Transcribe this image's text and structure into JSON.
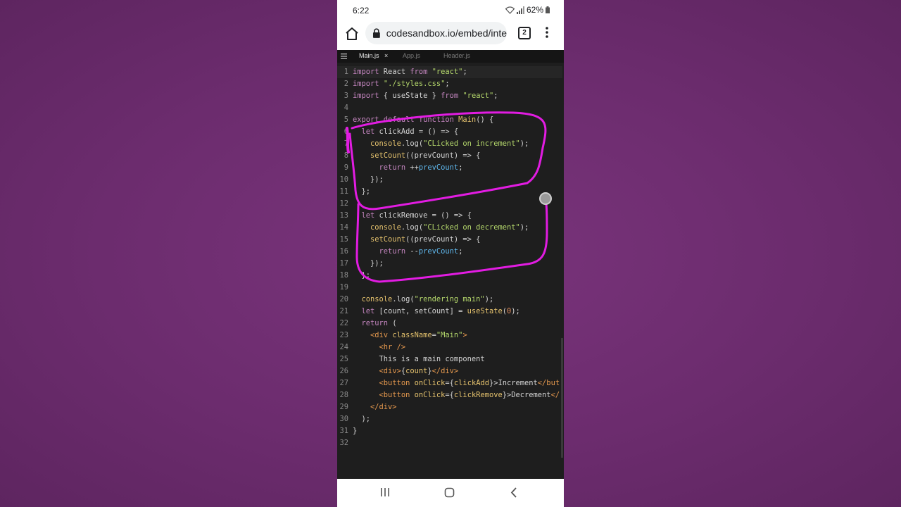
{
  "status_bar": {
    "time": "6:22",
    "battery": "62%"
  },
  "browser": {
    "url": "codesandbox.io/embed/inte",
    "tab_count": "2"
  },
  "editor": {
    "tabs": [
      {
        "label": "Main.js",
        "active": true
      },
      {
        "label": "App.js",
        "active": false
      },
      {
        "label": "Header.js",
        "active": false
      }
    ],
    "close_glyph": "×",
    "line_numbers": [
      "1",
      "2",
      "3",
      "4",
      "5",
      "6",
      "7",
      "8",
      "9",
      "10",
      "11",
      "12",
      "13",
      "14",
      "15",
      "16",
      "17",
      "18",
      "19",
      "20",
      "21",
      "22",
      "23",
      "24",
      "25",
      "26",
      "27",
      "28",
      "29",
      "30",
      "31",
      "32"
    ],
    "lines": [
      [
        [
          "kw",
          "import"
        ],
        [
          "p",
          " React "
        ],
        [
          "kw",
          "from"
        ],
        [
          "p",
          " "
        ],
        [
          "str",
          "\"react\""
        ],
        [
          "p",
          ";"
        ]
      ],
      [
        [
          "kw",
          "import"
        ],
        [
          "p",
          " "
        ],
        [
          "str",
          "\"./styles.css\""
        ],
        [
          "p",
          ";"
        ]
      ],
      [
        [
          "kw",
          "import"
        ],
        [
          "p",
          " { useState } "
        ],
        [
          "kw",
          "from"
        ],
        [
          "p",
          " "
        ],
        [
          "str",
          "\"react\""
        ],
        [
          "p",
          ";"
        ]
      ],
      [],
      [
        [
          "kw",
          "export default function"
        ],
        [
          "p",
          " "
        ],
        [
          "fn",
          "Main"
        ],
        [
          "p",
          "() {"
        ]
      ],
      [
        [
          "p",
          "  "
        ],
        [
          "kw",
          "let"
        ],
        [
          "p",
          " clickAdd = () => {"
        ]
      ],
      [
        [
          "p",
          "    "
        ],
        [
          "fn",
          "console"
        ],
        [
          "p",
          ".log("
        ],
        [
          "str",
          "\"CLicked on increment\""
        ],
        [
          "p",
          ");"
        ]
      ],
      [
        [
          "p",
          "    "
        ],
        [
          "fn",
          "setCount"
        ],
        [
          "p",
          "((prevCount) => {"
        ]
      ],
      [
        [
          "p",
          "      "
        ],
        [
          "kw",
          "return"
        ],
        [
          "p",
          " ++"
        ],
        [
          "var",
          "prevCount"
        ],
        [
          "p",
          ";"
        ]
      ],
      [
        [
          "p",
          "    });"
        ]
      ],
      [
        [
          "p",
          "  };"
        ]
      ],
      [],
      [
        [
          "p",
          "  "
        ],
        [
          "kw",
          "let"
        ],
        [
          "p",
          " clickRemove = () => {"
        ]
      ],
      [
        [
          "p",
          "    "
        ],
        [
          "fn",
          "console"
        ],
        [
          "p",
          ".log("
        ],
        [
          "str",
          "\"CLicked on decrement\""
        ],
        [
          "p",
          ");"
        ]
      ],
      [
        [
          "p",
          "    "
        ],
        [
          "fn",
          "setCount"
        ],
        [
          "p",
          "((prevCount) => {"
        ]
      ],
      [
        [
          "p",
          "      "
        ],
        [
          "kw",
          "return"
        ],
        [
          "p",
          " --"
        ],
        [
          "var",
          "prevCount"
        ],
        [
          "p",
          ";"
        ]
      ],
      [
        [
          "p",
          "    });"
        ]
      ],
      [
        [
          "p",
          "  };"
        ]
      ],
      [],
      [
        [
          "p",
          "  "
        ],
        [
          "fn",
          "console"
        ],
        [
          "p",
          ".log("
        ],
        [
          "str",
          "\"rendering main\""
        ],
        [
          "p",
          ");"
        ]
      ],
      [
        [
          "p",
          "  "
        ],
        [
          "kw",
          "let"
        ],
        [
          "p",
          " [count, setCount] = "
        ],
        [
          "fn",
          "useState"
        ],
        [
          "p",
          "("
        ],
        [
          "num",
          "0"
        ],
        [
          "p",
          ");"
        ]
      ],
      [
        [
          "p",
          "  "
        ],
        [
          "kw",
          "return"
        ],
        [
          "p",
          " ("
        ]
      ],
      [
        [
          "p",
          "    "
        ],
        [
          "tag",
          "<div"
        ],
        [
          "p",
          " "
        ],
        [
          "attr",
          "className"
        ],
        [
          "p",
          "="
        ],
        [
          "str",
          "\"Main\""
        ],
        [
          "tag",
          ">"
        ]
      ],
      [
        [
          "p",
          "      "
        ],
        [
          "tag",
          "<hr />"
        ]
      ],
      [
        [
          "p",
          "      This is a main component"
        ]
      ],
      [
        [
          "p",
          "      "
        ],
        [
          "tag",
          "<div>"
        ],
        [
          "p",
          "{"
        ],
        [
          "fn",
          "count"
        ],
        [
          "p",
          "}"
        ],
        [
          "tag",
          "</div>"
        ]
      ],
      [
        [
          "p",
          "      "
        ],
        [
          "tag",
          "<button"
        ],
        [
          "p",
          " "
        ],
        [
          "attr",
          "onClick"
        ],
        [
          "p",
          "={"
        ],
        [
          "fn",
          "clickAdd"
        ],
        [
          "p",
          "}>Increment"
        ],
        [
          "tag",
          "</but"
        ]
      ],
      [
        [
          "p",
          "      "
        ],
        [
          "tag",
          "<button"
        ],
        [
          "p",
          " "
        ],
        [
          "attr",
          "onClick"
        ],
        [
          "p",
          "={"
        ],
        [
          "fn",
          "clickRemove"
        ],
        [
          "p",
          "}>Decrement"
        ],
        [
          "tag",
          "</"
        ]
      ],
      [
        [
          "p",
          "    "
        ],
        [
          "tag",
          "</div>"
        ]
      ],
      [
        [
          "p",
          "  );"
        ]
      ],
      [
        [
          "p",
          "}"
        ]
      ],
      []
    ]
  },
  "icons": {
    "home": "home-icon",
    "lock": "lock-icon",
    "tabs": "tab-switcher-icon",
    "menu": "more-vert-icon",
    "recents": "recents-icon",
    "home_nav": "home-nav-icon",
    "back": "back-icon"
  },
  "colors": {
    "background": "#6a2b6c",
    "annotation": "#e21ce2",
    "editor_bg": "#1e1e1e"
  }
}
